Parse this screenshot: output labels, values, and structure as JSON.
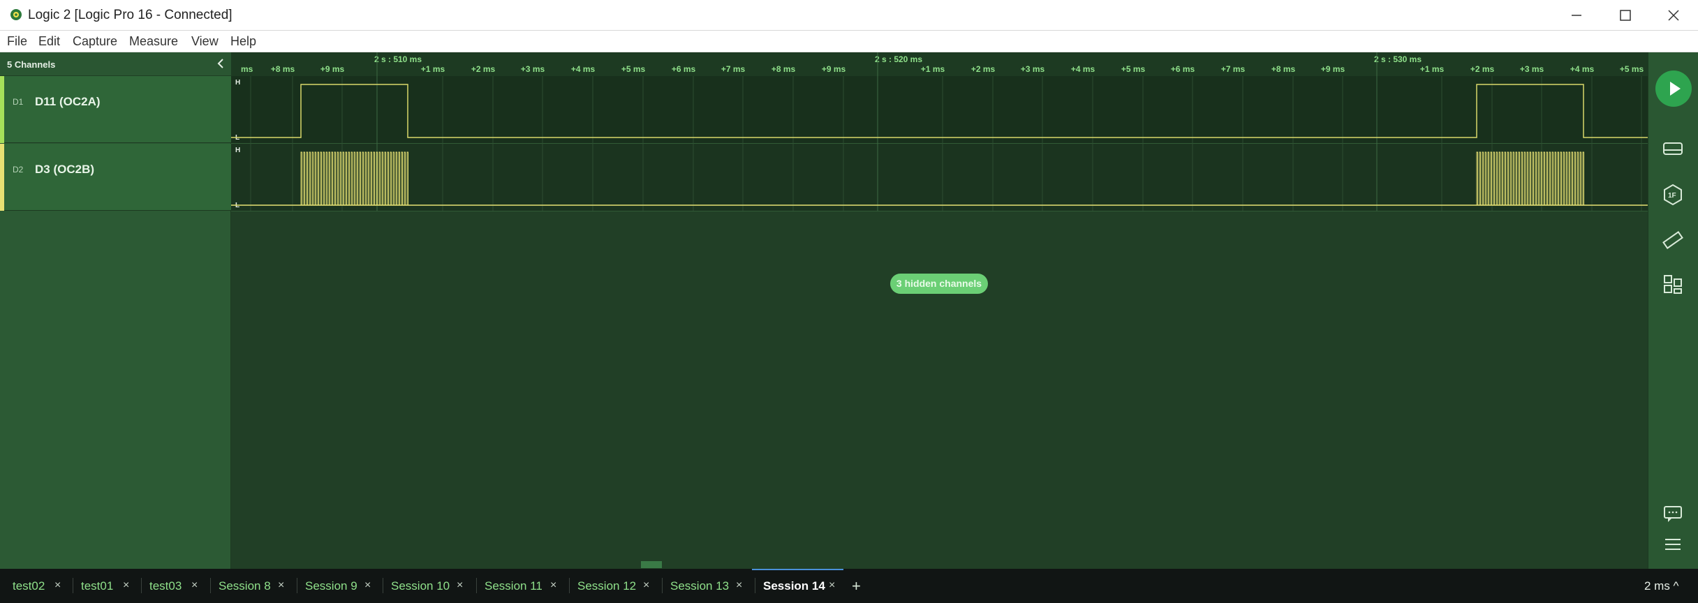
{
  "window": {
    "title": "Logic 2 [Logic Pro 16 - Connected]",
    "controls": [
      "minimize-icon",
      "maximize-icon",
      "close-icon"
    ]
  },
  "menu": [
    "File",
    "Edit",
    "Capture",
    "Measure",
    "View",
    "Help"
  ],
  "channels_panel": {
    "count_label": "5 Channels",
    "channels": [
      {
        "index": "D1",
        "name": "D11 (OC2A)",
        "color": "#a6e05a"
      },
      {
        "index": "D2",
        "name": "D3 (OC2B)",
        "color": "#e7e173"
      }
    ]
  },
  "timeline": {
    "major_labels": [
      "2 s : 510 ms",
      "2 s : 520 ms",
      "2 s : 530 ms"
    ],
    "minor_labels": [
      "ms",
      "+8 ms",
      "+9 ms",
      "+1 ms",
      "+2 ms",
      "+3 ms",
      "+4 ms",
      "+5 ms",
      "+6 ms",
      "+7 ms",
      "+8 ms",
      "+9 ms",
      "+1 ms",
      "+2 ms",
      "+3 ms",
      "+4 ms",
      "+5 ms",
      "+6 ms",
      "+7 ms",
      "+8 ms",
      "+9 ms",
      "+1 ms",
      "+2 ms",
      "+3 ms",
      "+4 ms",
      "+5 ms"
    ],
    "level_high": "H",
    "level_low": "L",
    "hidden_channels_label": "3 hidden channels"
  },
  "colors": {
    "accent": "#8fe08a",
    "signal_d1": "#d9d86a",
    "signal_d2": "#e7e173",
    "play": "#2ea44f"
  },
  "right_toolbar": [
    "play-icon",
    "timing-markers-icon",
    "analyzers-icon",
    "measure-ruler-icon",
    "extensions-icon",
    "feedback-icon",
    "menu-icon"
  ],
  "tabs": [
    {
      "label": "test02",
      "active": false
    },
    {
      "label": "test01",
      "active": false
    },
    {
      "label": "test03",
      "active": false
    },
    {
      "label": "Session 8",
      "active": false
    },
    {
      "label": "Session 9",
      "active": false
    },
    {
      "label": "Session 10",
      "active": false
    },
    {
      "label": "Session 11",
      "active": false
    },
    {
      "label": "Session 12",
      "active": false
    },
    {
      "label": "Session 13",
      "active": false
    },
    {
      "label": "Session 14",
      "active": true
    }
  ],
  "add_tab_label": "+",
  "zoom_label": "2 ms ^"
}
